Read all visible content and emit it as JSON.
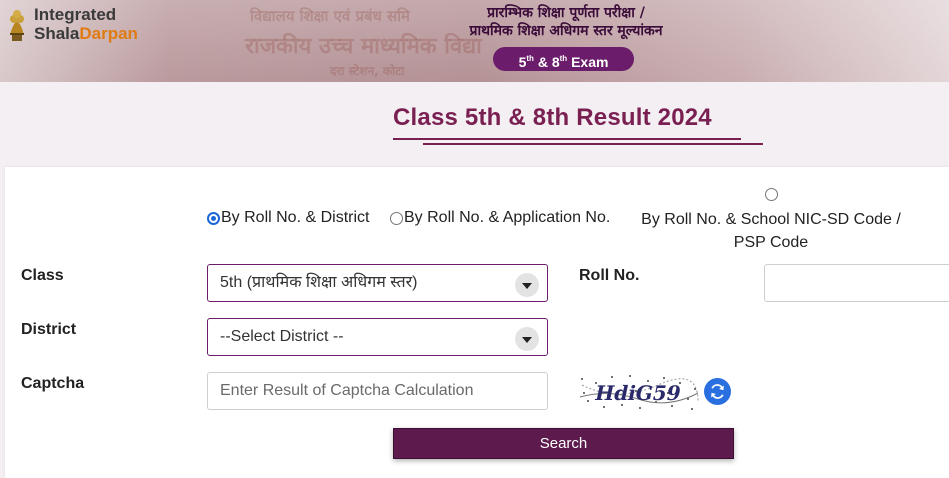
{
  "header": {
    "logo_line1": "Integrated",
    "logo_line2_a": "Shala",
    "logo_line2_b": "Darpan",
    "exam_title_line1": "प्रारम्भिक शिक्षा पूर्णता परीक्षा /",
    "exam_title_line2": "प्राथमिक शिक्षा अधिगम स्तर मूल्यांकन",
    "exam_pill": {
      "a": "5",
      "a_sup": "th",
      "amp": "&",
      "b": "8",
      "b_sup": "th",
      "word": "Exam"
    },
    "banner_text_1": "विद्यालय शिक्षा एवं प्रबंध समि",
    "banner_text_2": "राजकीय उच्च माध्यमिक विद्या",
    "banner_text_3": "दरा स्टेशन, कोटा"
  },
  "page_title": "Class 5th & 8th Result 2024",
  "search_modes": [
    {
      "label": "By Roll No. & District",
      "checked": true
    },
    {
      "label": "By Roll No. & Application No.",
      "checked": false
    },
    {
      "label_line1": "By Roll No. & School NIC-SD Code /",
      "label_line2": "PSP Code",
      "checked": false
    }
  ],
  "form": {
    "class_label": "Class",
    "class_value": "5th (प्राथमिक शिक्षा अधिगम स्तर)",
    "district_label": "District",
    "district_value": "--Select District --",
    "roll_label": "Roll No.",
    "roll_value": "",
    "captcha_label": "Captcha",
    "captcha_placeholder": "Enter Result of Captcha Calculation",
    "captcha_text": "HdiG59",
    "search_label": "Search"
  },
  "colors": {
    "brand": "#6b1d6b",
    "title": "#7a1f52",
    "button": "#5c1a4d",
    "radio": "#1a66d6",
    "logo_accent": "#e07b12"
  },
  "icons": [
    "emblem-icon",
    "refresh-icon",
    "chevron-down-icon"
  ]
}
